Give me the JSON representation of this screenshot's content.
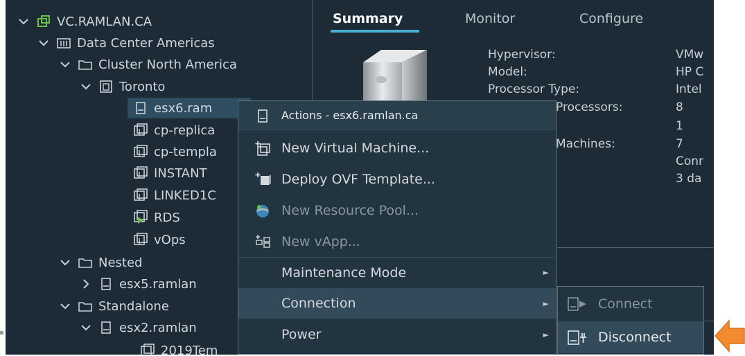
{
  "tree": {
    "items": [
      {
        "label": "VC.RAMLAN.CA"
      },
      {
        "label": "Data Center Americas"
      },
      {
        "label": "Cluster North America"
      },
      {
        "label": "Toronto"
      },
      {
        "label": "esx6.ram"
      },
      {
        "label": "cp-replica"
      },
      {
        "label": "cp-templa"
      },
      {
        "label": "INSTANT"
      },
      {
        "label": "LINKED1C"
      },
      {
        "label": "RDS"
      },
      {
        "label": "vOps"
      },
      {
        "label": "Nested"
      },
      {
        "label": "esx5.ramlan"
      },
      {
        "label": "Standalone"
      },
      {
        "label": "esx2.ramlan"
      },
      {
        "label": "2019Tem"
      }
    ]
  },
  "tabs": [
    {
      "label": "Summary"
    },
    {
      "label": "Monitor"
    },
    {
      "label": "Configure"
    }
  ],
  "summary": {
    "labels": [
      "Hypervisor:",
      "Model:",
      "Processor Type:",
      "Processors:",
      "",
      "Machines:"
    ],
    "values": [
      "VMw",
      "HP C",
      "Intel",
      "8",
      "1",
      "7",
      "Conr",
      "3 da"
    ]
  },
  "context_menu": {
    "title": "Actions - esx6.ramlan.ca",
    "items": [
      {
        "label": "New Virtual Machine..."
      },
      {
        "label": "Deploy OVF Template..."
      },
      {
        "label": "New Resource Pool..."
      },
      {
        "label": "New vApp..."
      },
      {
        "label": "Maintenance Mode"
      },
      {
        "label": "Connection"
      },
      {
        "label": "Power"
      }
    ]
  },
  "submenu": {
    "items": [
      {
        "label": "Connect"
      },
      {
        "label": "Disconnect"
      }
    ]
  },
  "colors": {
    "background": "#1c2b36",
    "accent": "#49afd9",
    "vcenter_icon": "#6cc04a",
    "callout_arrow": "#f28a2e"
  }
}
